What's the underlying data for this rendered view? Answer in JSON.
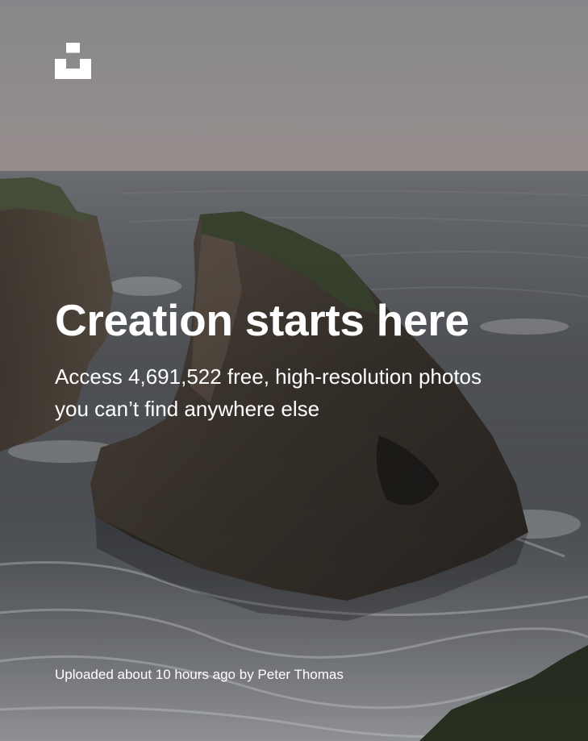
{
  "hero": {
    "title": "Creation starts here",
    "subtitle": "Access 4,691,522 free, high-resolution photos you can’t find anywhere else"
  },
  "credit": {
    "prefix": "Uploaded about 10 hours ago by ",
    "author": "Peter Thomas"
  },
  "logo": {
    "icon": "unsplash-logo-icon"
  },
  "background": {
    "subject": "sea-stack-photo",
    "sky_color": "#a4a0a1",
    "sea_color": "#5e6166",
    "rock_color": "#3a342d"
  }
}
